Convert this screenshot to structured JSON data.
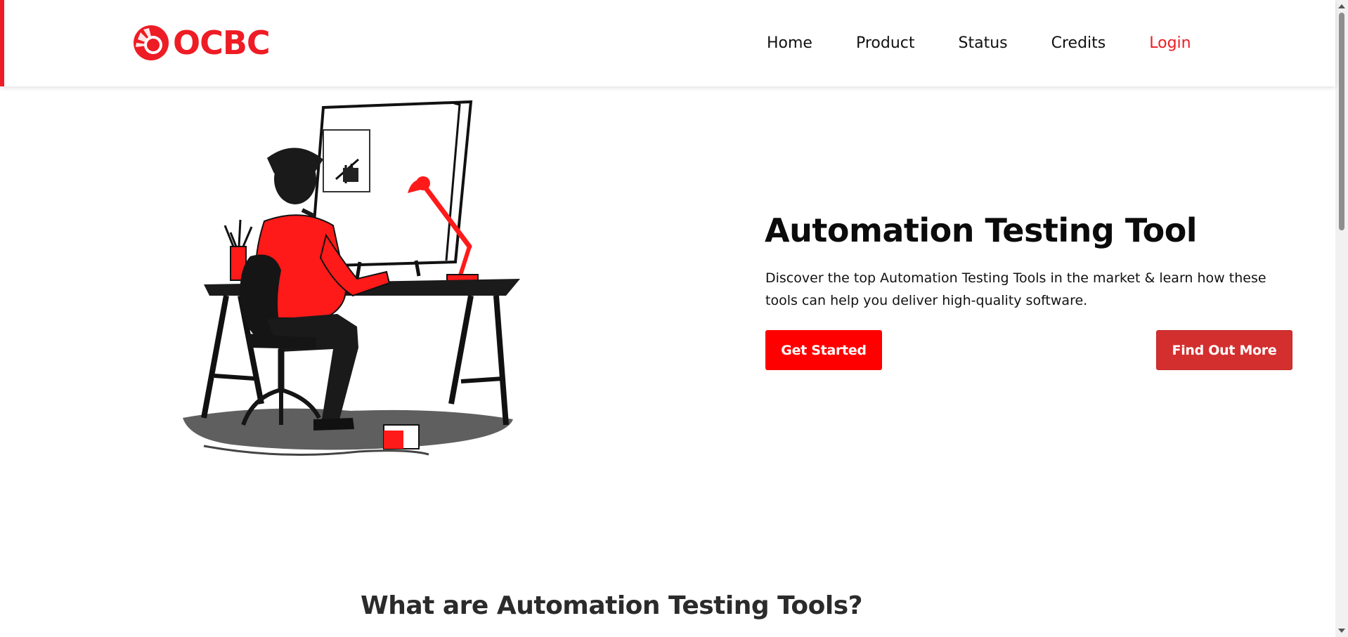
{
  "brand": {
    "logo_text": "OCBC",
    "color": "#ee1c25"
  },
  "nav": {
    "items": [
      {
        "label": "Home"
      },
      {
        "label": "Product"
      },
      {
        "label": "Status"
      },
      {
        "label": "Credits"
      },
      {
        "label": "Login"
      }
    ],
    "login_color": "#ee1c25"
  },
  "hero": {
    "title": "Automation Testing Tool",
    "description": "Discover the top Automation Testing Tools in the market & learn how these tools can help you deliver high-quality software.",
    "primary_button": "Get Started",
    "secondary_button": "Find Out More",
    "primary_color": "#ff0000",
    "secondary_color": "#d32f2f"
  },
  "section": {
    "title": "What are Automation Testing Tools?"
  },
  "illustration": {
    "icon": "person-at-desk-illustration"
  }
}
